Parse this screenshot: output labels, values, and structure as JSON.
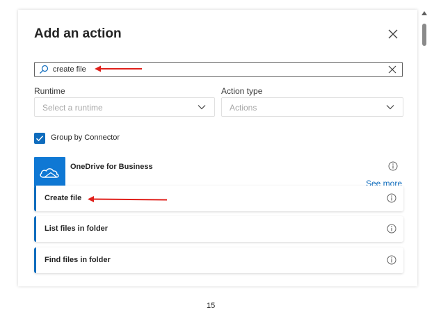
{
  "dialog": {
    "title": "Add an action"
  },
  "search": {
    "value": "create file",
    "icon": "search-icon"
  },
  "filters": {
    "runtime": {
      "label": "Runtime",
      "placeholder": "Select a runtime"
    },
    "action_type": {
      "label": "Action type",
      "placeholder": "Actions"
    }
  },
  "group_by_connector": {
    "label": "Group by Connector",
    "checked": true
  },
  "connector": {
    "name": "OneDrive for Business",
    "icon": "onedrive-cloud-icon",
    "see_more": "See more"
  },
  "actions": [
    {
      "label": "Create file"
    },
    {
      "label": "List files in folder"
    },
    {
      "label": "Find files in folder"
    }
  ],
  "annotations": {
    "arrow_color": "#e0201b"
  },
  "colors": {
    "accent": "#0f6cbd",
    "connector_tile": "#0f78d4"
  },
  "footer": {
    "partial_text": "15"
  }
}
